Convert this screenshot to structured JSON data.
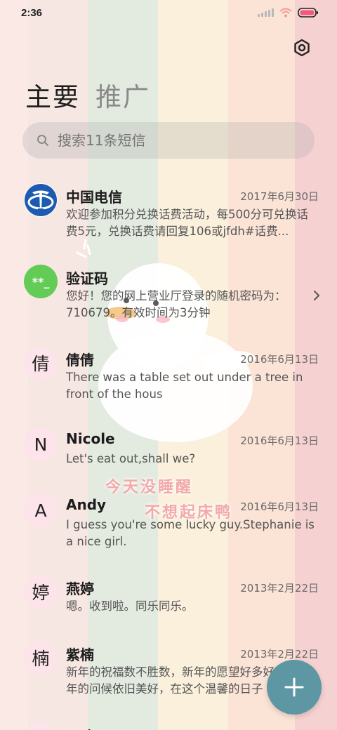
{
  "status_bar": {
    "time": "2:36",
    "icons": [
      "signal-icon",
      "wifi-icon",
      "battery-icon"
    ]
  },
  "header": {
    "settings_icon": "gear-icon",
    "tabs": [
      {
        "label": "主要",
        "active": true
      },
      {
        "label": "推广",
        "active": false
      }
    ]
  },
  "search": {
    "placeholder": "搜索11条短信",
    "icon": "search-icon"
  },
  "watermark": {
    "line1": "今天没睡醒",
    "line2": "不想起床鸭"
  },
  "messages": [
    {
      "avatar": "telecom-logo",
      "name": "中国电信",
      "date": "2017年6月30日",
      "preview": "欢迎参加积分兑换话费活动，每500分可兑换话费5元，兑换话费请回复106或jfdh#话费..."
    },
    {
      "avatar": "**_",
      "name": "验证码",
      "date": "",
      "preview": "您好！您的网上营业厅登录的随机密码为：710679。有效时间为3分钟"
    },
    {
      "avatar": "倩",
      "name": "倩倩",
      "date": "2016年6月13日",
      "preview": "There was a table set out under a tree in front of the hous"
    },
    {
      "avatar": "N",
      "name": "Nicole",
      "date": "2016年6月13日",
      "preview": "Let's eat out,shall we?"
    },
    {
      "avatar": "A",
      "name": "Andy",
      "date": "2016年6月13日",
      "preview": "I guess you're some lucky guy.Stephanie is a nice girl."
    },
    {
      "avatar": "婷",
      "name": "燕婷",
      "date": "2013年2月22日",
      "preview": "嗯。收到啦。同乐同乐。"
    },
    {
      "avatar": "楠",
      "name": "紫楠",
      "date": "2013年2月22日",
      "preview": "新年的祝福数不胜数，新年的愿望好多好多，新年的问候依旧美好，在这个温馨的日子"
    },
    {
      "avatar": "",
      "name": "子玲",
      "date": "",
      "preview": ""
    }
  ],
  "fab": {
    "icon": "plus-icon"
  },
  "colors": {
    "accent": "#5e97a4",
    "verification_avatar": "#62cc57",
    "telecom_blue": "#1d5bb0"
  }
}
